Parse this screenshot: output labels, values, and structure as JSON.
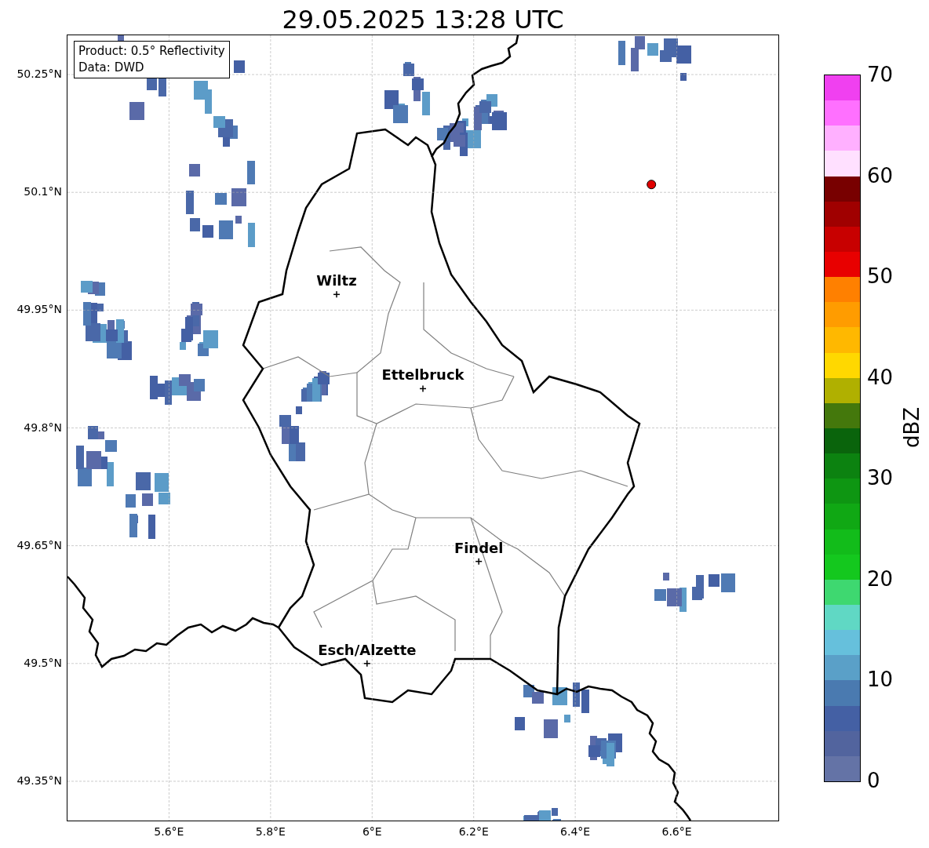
{
  "chart_data": {
    "type": "scatter",
    "title": "29.05.2025 13:28 UTC",
    "xlim": [
      5.4,
      6.8
    ],
    "grid": true,
    "ylim": [
      49.3,
      50.3
    ],
    "xticks": [
      {
        "value": 5.6,
        "label": "5.6°E"
      },
      {
        "value": 5.8,
        "label": "5.8°E"
      },
      {
        "value": 6.0,
        "label": "6°E"
      },
      {
        "value": 6.2,
        "label": "6.2°E"
      },
      {
        "value": 6.4,
        "label": "6.4°E"
      },
      {
        "value": 6.6,
        "label": "6.6°E"
      }
    ],
    "yticks": [
      {
        "value": 50.25,
        "label": "50.25°N"
      },
      {
        "value": 50.1,
        "label": "50.1°N"
      },
      {
        "value": 49.95,
        "label": "49.95°N"
      },
      {
        "value": 49.8,
        "label": "49.8°N"
      },
      {
        "value": 49.65,
        "label": "49.65°N"
      },
      {
        "value": 49.5,
        "label": "49.5°N"
      },
      {
        "value": 49.35,
        "label": "49.35°N"
      }
    ],
    "x": [
      5.93,
      6.1,
      6.21,
      5.99,
      6.55
    ],
    "series": [
      {
        "color": "#000000",
        "values": [
          49.97,
          49.85,
          49.63,
          49.5,
          null
        ]
      },
      {
        "color": "#e00000",
        "values": [
          null,
          null,
          null,
          null,
          50.11
        ]
      }
    ]
  },
  "city_labels": [
    "Wiltz",
    "Ettelbruck",
    "Findel",
    "Esch/Alzette"
  ],
  "info_box": [
    "Product: 0.5° Reflectivity",
    "Data: DWD"
  ],
  "colorbar": {
    "label": "dBZ",
    "ticks": [
      "70",
      "60",
      "50",
      "40",
      "30",
      "20",
      "10",
      "0"
    ],
    "bands": [
      {
        "color": "#6473a6"
      },
      {
        "color": "#52649e"
      },
      {
        "color": "#4460a4"
      },
      {
        "color": "#4a7ab0"
      },
      {
        "color": "#5aa0c8"
      },
      {
        "color": "#66c0dc"
      },
      {
        "color": "#60d8c4"
      },
      {
        "color": "#3ed870"
      },
      {
        "color": "#14c81e"
      },
      {
        "color": "#12bc1a"
      },
      {
        "color": "#10a814"
      },
      {
        "color": "#0e9612"
      },
      {
        "color": "#0c8210"
      },
      {
        "color": "#0a640c"
      },
      {
        "color": "#44780c"
      },
      {
        "color": "#b0b000"
      },
      {
        "color": "#ffd800"
      },
      {
        "color": "#ffb800"
      },
      {
        "color": "#ff9c00"
      },
      {
        "color": "#ff8000"
      },
      {
        "color": "#e80000"
      },
      {
        "color": "#c80000"
      },
      {
        "color": "#a00000"
      },
      {
        "color": "#780000"
      },
      {
        "color": "#ffe0ff"
      },
      {
        "color": "#ffb0ff"
      },
      {
        "color": "#ff70ff"
      },
      {
        "color": "#f040f0"
      }
    ]
  }
}
